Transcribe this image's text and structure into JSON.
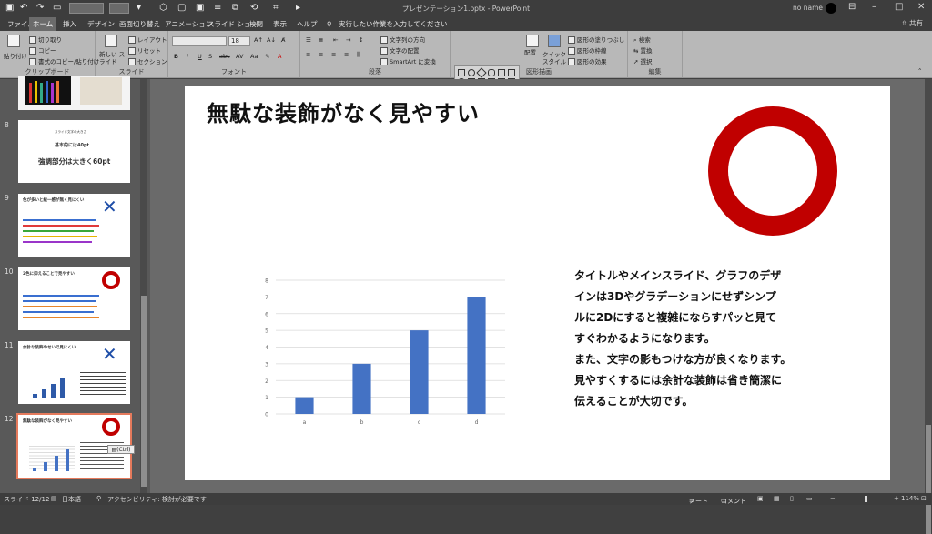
{
  "titlebar": {
    "doc_title": "プレゼンテーション1.pptx  -  PowerPoint",
    "user": "no name",
    "font_box": "",
    "share": "共有"
  },
  "tabs": [
    "ファイル",
    "ホーム",
    "挿入",
    "デザイン",
    "画面切り替え",
    "アニメーション",
    "スライド ショー",
    "校閲",
    "表示",
    "ヘルプ"
  ],
  "tell_me": "実行したい作業を入力してください",
  "ribbon": {
    "clipboard": {
      "paste": "貼り付け",
      "cut": "切り取り",
      "copy": "コピー",
      "format_painter": "書式のコピー/貼り付け",
      "label": "クリップボード"
    },
    "slides": {
      "new_slide": "新しい スライド",
      "layout": "レイアウト",
      "reset": "リセット",
      "section": "セクション",
      "label": "スライド"
    },
    "font": {
      "size": "18",
      "label": "フォント"
    },
    "paragraph": {
      "text_dir": "文字列の方向",
      "align_text": "文字の配置",
      "smartart": "SmartArt に変換",
      "label": "段落"
    },
    "drawing": {
      "arrange": "配置",
      "quick_styles": "クイック スタイル",
      "fill": "図形の塗りつぶし",
      "outline": "図形の枠線",
      "effects": "図形の効果",
      "label": "図形描画"
    },
    "editing": {
      "find": "検索",
      "replace": "置換",
      "select": "選択",
      "label": "編集"
    }
  },
  "thumbnails": [
    {
      "num": "8",
      "line1": "スライド文字の大きさ",
      "line2": "基本的には40pt",
      "line3": "強調部分は大きく60pt"
    },
    {
      "num": "9",
      "title": "色が多いと統一感が無く見にくい",
      "mark": "✕"
    },
    {
      "num": "10",
      "title": "2色に抑えることで見やすい",
      "mark": "○"
    },
    {
      "num": "11",
      "title": "余計な装飾のせいで見にくい",
      "mark": "✕"
    },
    {
      "num": "12",
      "title": "無駄な装飾がなく見やすい",
      "mark": "○"
    }
  ],
  "ctrl_tag": "(Ctrl)",
  "slide": {
    "title": "無駄な装飾がなく見やすい",
    "body_lines": [
      "タイトルやメインスライド、グラフのデザ",
      "インは3Dやグラデーションにせずシンプ",
      "ルに2Dにすると複雑にならすパッと見て",
      "すぐわかるようになります。",
      "また、文字の影もつけな方が良くなります。",
      "見やすくするには余計な装飾は省き簡潔に",
      "伝えることが大切です。"
    ]
  },
  "chart_data": {
    "type": "bar",
    "categories": [
      "a",
      "b",
      "c",
      "d"
    ],
    "values": [
      1,
      3,
      5,
      7
    ],
    "ylim": [
      0,
      8
    ],
    "yticks": [
      "0",
      "1",
      "2",
      "3",
      "4",
      "5",
      "6",
      "7",
      "8"
    ],
    "color": "#4472c4",
    "grid": true
  },
  "status": {
    "slide": "スライド 12/12",
    "lang": "日本語",
    "accessibility": "アクセシビリティ: 検討が必要です",
    "notes": "ノート",
    "comments": "コメント",
    "zoom": "114%"
  }
}
